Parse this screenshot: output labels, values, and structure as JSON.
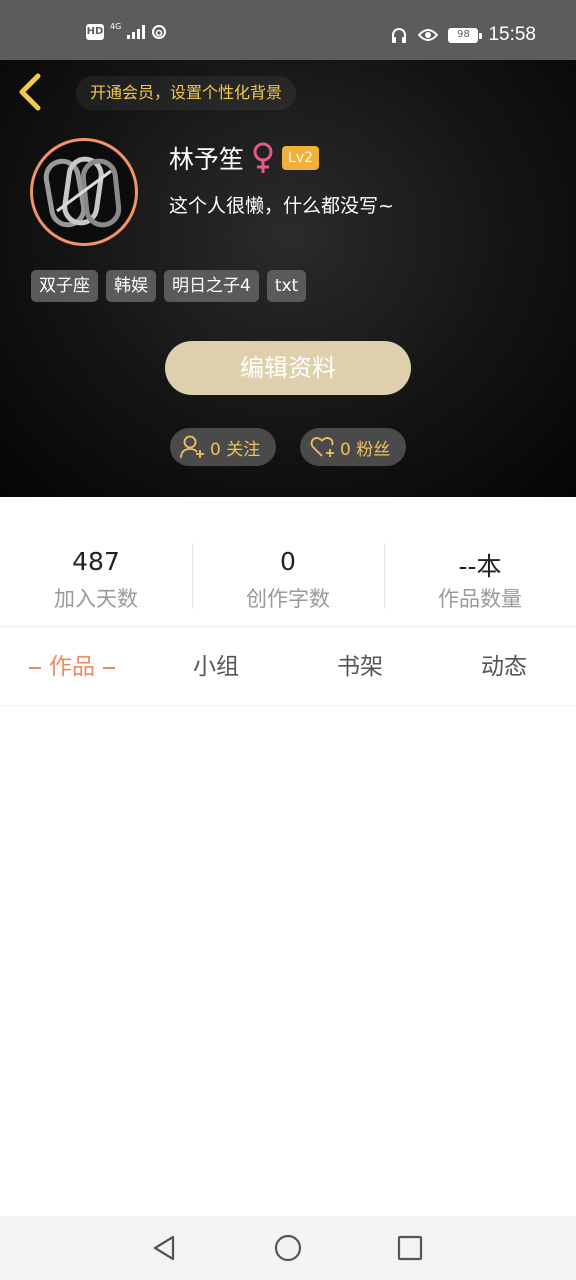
{
  "status_bar": {
    "hd": "HD",
    "network": "4G",
    "battery": "98",
    "time": "15:58",
    "icons": [
      "signal-icon",
      "sync-icon",
      "headphones-icon",
      "eye-icon",
      "battery-icon"
    ]
  },
  "header": {
    "vip_banner": "开通会员，设置个性化背景",
    "username": "林予笙",
    "gender": "female",
    "level": "Lv2",
    "bio": "这个人很懒，什么都没写~",
    "tags": [
      "双子座",
      "韩娱",
      "明日之子4",
      "txt"
    ],
    "edit_button": "编辑资料",
    "following_label": "0 关注",
    "fans_label": "0 粉丝"
  },
  "stats": [
    {
      "value": "487",
      "label": "加入天数"
    },
    {
      "value": "0",
      "label": "创作字数"
    },
    {
      "value": "--本",
      "label": "作品数量"
    }
  ],
  "tabs": [
    {
      "label": "作品",
      "active": true
    },
    {
      "label": "小组",
      "active": false
    },
    {
      "label": "书架",
      "active": false
    },
    {
      "label": "动态",
      "active": false
    }
  ],
  "colors": {
    "accent": "#ef8a5e",
    "gold": "#f0c05a",
    "level_badge": "#f0b03c",
    "edit_button": "#ded0ad",
    "gender": "#e05a8c"
  }
}
